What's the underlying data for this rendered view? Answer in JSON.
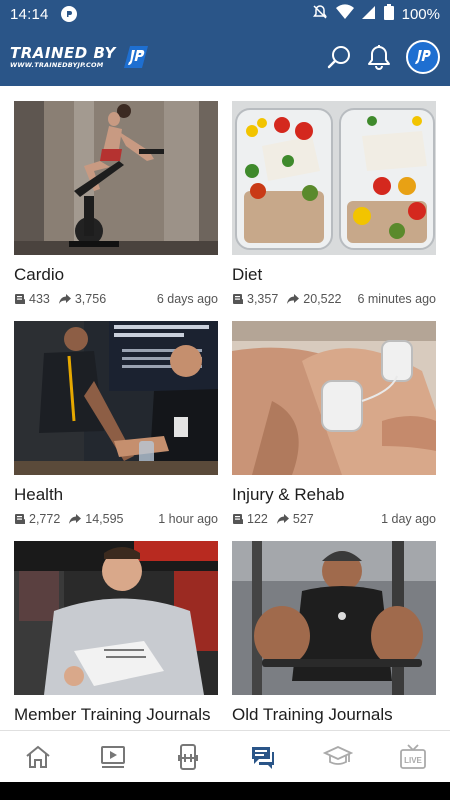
{
  "status_bar": {
    "time": "14:14",
    "battery": "100%"
  },
  "header": {
    "logo_title": "TRAINED BY",
    "logo_url": "WWW.TRAINEDBYJP.COM",
    "avatar_initials": "JP",
    "icons": [
      "search-icon",
      "bell-icon",
      "avatar"
    ]
  },
  "colors": {
    "header_bg": "#2a5588",
    "active_nav": "#2a5588",
    "inactive_nav": "#777777"
  },
  "categories": [
    {
      "title": "Cardio",
      "posts": "433",
      "shares": "3,756",
      "time": "6 days ago"
    },
    {
      "title": "Diet",
      "posts": "3,357",
      "shares": "20,522",
      "time": "6 minutes ago"
    },
    {
      "title": "Health",
      "posts": "2,772",
      "shares": "14,595",
      "time": "1 hour ago"
    },
    {
      "title": "Injury & Rehab",
      "posts": "122",
      "shares": "527",
      "time": "1 day ago"
    },
    {
      "title": "Member Training Journals",
      "posts": "",
      "shares": "",
      "time": ""
    },
    {
      "title": "Old Training Journals",
      "posts": "",
      "shares": "",
      "time": ""
    }
  ],
  "nav": {
    "items": [
      "home-icon",
      "video-icon",
      "workout-phone-icon",
      "forum-icon",
      "education-icon",
      "live-icon"
    ],
    "active": "forum-icon",
    "live_label": "LIVE"
  }
}
